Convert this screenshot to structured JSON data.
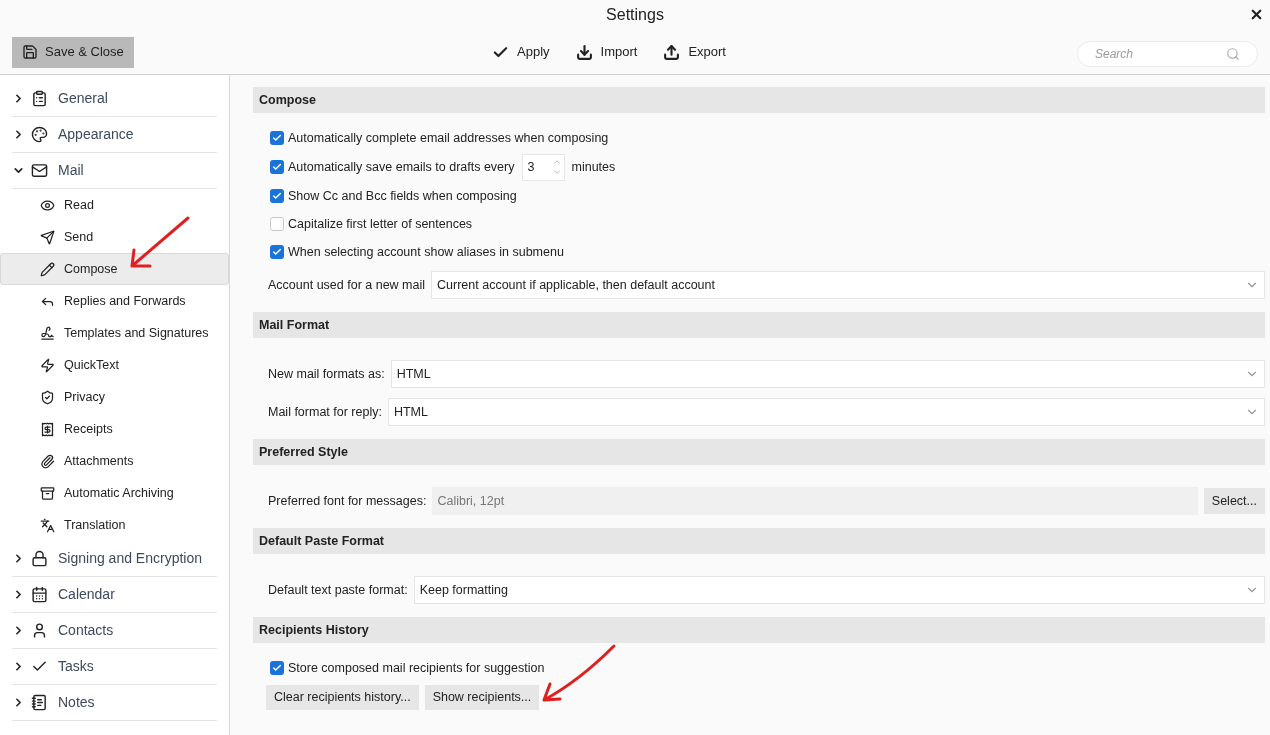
{
  "window": {
    "title": "Settings"
  },
  "toolbar": {
    "save_close": "Save & Close",
    "actions": [
      "Apply",
      "Import",
      "Export"
    ],
    "search": {
      "placeholder": "Search"
    }
  },
  "sidebar": {
    "items": [
      {
        "label": "General",
        "expanded": false
      },
      {
        "label": "Appearance",
        "expanded": false
      },
      {
        "label": "Mail",
        "expanded": true,
        "children": [
          {
            "label": "Read",
            "selected": false
          },
          {
            "label": "Send",
            "selected": false
          },
          {
            "label": "Compose",
            "selected": true
          },
          {
            "label": "Replies and Forwards",
            "selected": false
          },
          {
            "label": "Templates and Signatures",
            "selected": false
          },
          {
            "label": "QuickText",
            "selected": false
          },
          {
            "label": "Privacy",
            "selected": false
          },
          {
            "label": "Receipts",
            "selected": false
          },
          {
            "label": "Attachments",
            "selected": false
          },
          {
            "label": "Automatic Archiving",
            "selected": false
          },
          {
            "label": "Translation",
            "selected": false
          }
        ]
      },
      {
        "label": "Signing and Encryption",
        "expanded": false
      },
      {
        "label": "Calendar",
        "expanded": false
      },
      {
        "label": "Contacts",
        "expanded": false
      },
      {
        "label": "Tasks",
        "expanded": false
      },
      {
        "label": "Notes",
        "expanded": false
      }
    ]
  },
  "sections": [
    {
      "title": "Compose",
      "rows": [
        {
          "kind": "checkbox",
          "label": "Automatically complete email addresses when composing",
          "checked": true
        },
        {
          "kind": "checkbox_spinner",
          "label": "Automatically save emails to drafts every",
          "checked": true,
          "value": "3",
          "unit": "minutes"
        },
        {
          "kind": "checkbox",
          "label": "Show Cc and Bcc fields when composing",
          "checked": true
        },
        {
          "kind": "checkbox",
          "label": "Capitalize first letter of sentences",
          "checked": false
        },
        {
          "kind": "checkbox",
          "label": "When selecting account show aliases in submenu",
          "checked": true
        },
        {
          "kind": "select",
          "label": "Account used for a new mail",
          "value": "Current account if applicable, then default account"
        }
      ]
    },
    {
      "title": "Mail Format",
      "rows": [
        {
          "kind": "select",
          "label": "New mail formats as:",
          "value": "HTML"
        },
        {
          "kind": "select",
          "label": "Mail format for reply:",
          "value": "HTML"
        }
      ]
    },
    {
      "title": "Preferred Style",
      "rows": [
        {
          "kind": "font_picker",
          "label": "Preferred font for messages:",
          "value": "Calibri, 12pt",
          "button": "Select..."
        }
      ]
    },
    {
      "title": "Default Paste Format",
      "rows": [
        {
          "kind": "select",
          "label": "Default text paste format:",
          "value": "Keep formatting"
        }
      ]
    },
    {
      "title": "Recipients History",
      "rows": [
        {
          "kind": "checkbox",
          "label": "Store composed mail recipients for suggestion",
          "checked": true
        },
        {
          "kind": "buttons",
          "buttons": [
            "Clear recipients history...",
            "Show recipients..."
          ]
        }
      ]
    }
  ]
}
